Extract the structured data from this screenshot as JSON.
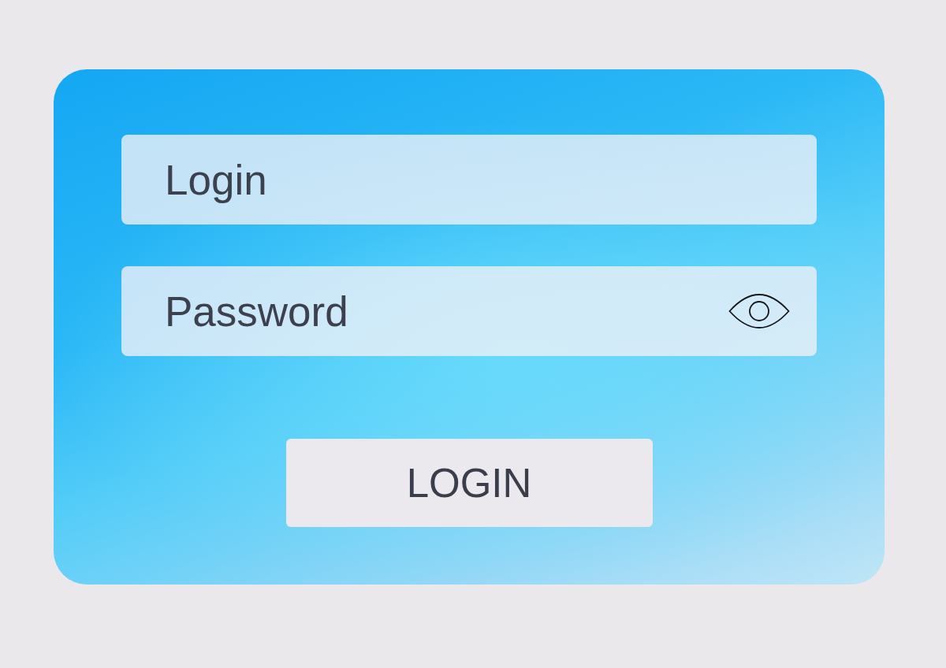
{
  "login_form": {
    "fields": [
      {
        "placeholder": "Login",
        "show_password_toggle": false
      },
      {
        "placeholder": "Password",
        "show_password_toggle": true
      }
    ],
    "submit_button": {
      "label": "LOGIN"
    }
  }
}
